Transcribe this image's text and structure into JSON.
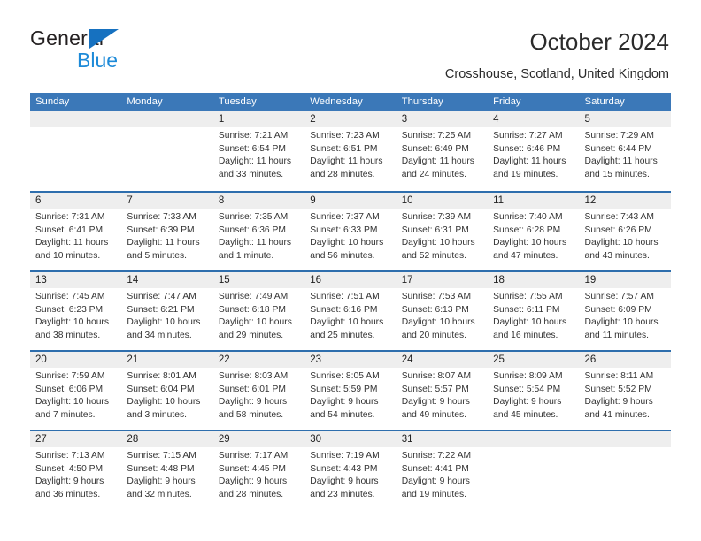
{
  "brand": {
    "name_top": "General",
    "name_bottom": "Blue",
    "accent_blue": "#1671c0",
    "light_blue": "#1d8ad8"
  },
  "header": {
    "title": "October 2024",
    "subtitle": "Crosshouse, Scotland, United Kingdom"
  },
  "calendar": {
    "header_bg": "#3b78b8",
    "row_border": "#2e6ead",
    "day_band_bg": "#eeeeee",
    "weekdays": [
      "Sunday",
      "Monday",
      "Tuesday",
      "Wednesday",
      "Thursday",
      "Friday",
      "Saturday"
    ],
    "weeks": [
      [
        {
          "day": "",
          "sunrise": "",
          "sunset": "",
          "daylight": "",
          "daylight2": ""
        },
        {
          "day": "",
          "sunrise": "",
          "sunset": "",
          "daylight": "",
          "daylight2": ""
        },
        {
          "day": "1",
          "sunrise": "Sunrise: 7:21 AM",
          "sunset": "Sunset: 6:54 PM",
          "daylight": "Daylight: 11 hours",
          "daylight2": "and 33 minutes."
        },
        {
          "day": "2",
          "sunrise": "Sunrise: 7:23 AM",
          "sunset": "Sunset: 6:51 PM",
          "daylight": "Daylight: 11 hours",
          "daylight2": "and 28 minutes."
        },
        {
          "day": "3",
          "sunrise": "Sunrise: 7:25 AM",
          "sunset": "Sunset: 6:49 PM",
          "daylight": "Daylight: 11 hours",
          "daylight2": "and 24 minutes."
        },
        {
          "day": "4",
          "sunrise": "Sunrise: 7:27 AM",
          "sunset": "Sunset: 6:46 PM",
          "daylight": "Daylight: 11 hours",
          "daylight2": "and 19 minutes."
        },
        {
          "day": "5",
          "sunrise": "Sunrise: 7:29 AM",
          "sunset": "Sunset: 6:44 PM",
          "daylight": "Daylight: 11 hours",
          "daylight2": "and 15 minutes."
        }
      ],
      [
        {
          "day": "6",
          "sunrise": "Sunrise: 7:31 AM",
          "sunset": "Sunset: 6:41 PM",
          "daylight": "Daylight: 11 hours",
          "daylight2": "and 10 minutes."
        },
        {
          "day": "7",
          "sunrise": "Sunrise: 7:33 AM",
          "sunset": "Sunset: 6:39 PM",
          "daylight": "Daylight: 11 hours",
          "daylight2": "and 5 minutes."
        },
        {
          "day": "8",
          "sunrise": "Sunrise: 7:35 AM",
          "sunset": "Sunset: 6:36 PM",
          "daylight": "Daylight: 11 hours",
          "daylight2": "and 1 minute."
        },
        {
          "day": "9",
          "sunrise": "Sunrise: 7:37 AM",
          "sunset": "Sunset: 6:33 PM",
          "daylight": "Daylight: 10 hours",
          "daylight2": "and 56 minutes."
        },
        {
          "day": "10",
          "sunrise": "Sunrise: 7:39 AM",
          "sunset": "Sunset: 6:31 PM",
          "daylight": "Daylight: 10 hours",
          "daylight2": "and 52 minutes."
        },
        {
          "day": "11",
          "sunrise": "Sunrise: 7:40 AM",
          "sunset": "Sunset: 6:28 PM",
          "daylight": "Daylight: 10 hours",
          "daylight2": "and 47 minutes."
        },
        {
          "day": "12",
          "sunrise": "Sunrise: 7:43 AM",
          "sunset": "Sunset: 6:26 PM",
          "daylight": "Daylight: 10 hours",
          "daylight2": "and 43 minutes."
        }
      ],
      [
        {
          "day": "13",
          "sunrise": "Sunrise: 7:45 AM",
          "sunset": "Sunset: 6:23 PM",
          "daylight": "Daylight: 10 hours",
          "daylight2": "and 38 minutes."
        },
        {
          "day": "14",
          "sunrise": "Sunrise: 7:47 AM",
          "sunset": "Sunset: 6:21 PM",
          "daylight": "Daylight: 10 hours",
          "daylight2": "and 34 minutes."
        },
        {
          "day": "15",
          "sunrise": "Sunrise: 7:49 AM",
          "sunset": "Sunset: 6:18 PM",
          "daylight": "Daylight: 10 hours",
          "daylight2": "and 29 minutes."
        },
        {
          "day": "16",
          "sunrise": "Sunrise: 7:51 AM",
          "sunset": "Sunset: 6:16 PM",
          "daylight": "Daylight: 10 hours",
          "daylight2": "and 25 minutes."
        },
        {
          "day": "17",
          "sunrise": "Sunrise: 7:53 AM",
          "sunset": "Sunset: 6:13 PM",
          "daylight": "Daylight: 10 hours",
          "daylight2": "and 20 minutes."
        },
        {
          "day": "18",
          "sunrise": "Sunrise: 7:55 AM",
          "sunset": "Sunset: 6:11 PM",
          "daylight": "Daylight: 10 hours",
          "daylight2": "and 16 minutes."
        },
        {
          "day": "19",
          "sunrise": "Sunrise: 7:57 AM",
          "sunset": "Sunset: 6:09 PM",
          "daylight": "Daylight: 10 hours",
          "daylight2": "and 11 minutes."
        }
      ],
      [
        {
          "day": "20",
          "sunrise": "Sunrise: 7:59 AM",
          "sunset": "Sunset: 6:06 PM",
          "daylight": "Daylight: 10 hours",
          "daylight2": "and 7 minutes."
        },
        {
          "day": "21",
          "sunrise": "Sunrise: 8:01 AM",
          "sunset": "Sunset: 6:04 PM",
          "daylight": "Daylight: 10 hours",
          "daylight2": "and 3 minutes."
        },
        {
          "day": "22",
          "sunrise": "Sunrise: 8:03 AM",
          "sunset": "Sunset: 6:01 PM",
          "daylight": "Daylight: 9 hours",
          "daylight2": "and 58 minutes."
        },
        {
          "day": "23",
          "sunrise": "Sunrise: 8:05 AM",
          "sunset": "Sunset: 5:59 PM",
          "daylight": "Daylight: 9 hours",
          "daylight2": "and 54 minutes."
        },
        {
          "day": "24",
          "sunrise": "Sunrise: 8:07 AM",
          "sunset": "Sunset: 5:57 PM",
          "daylight": "Daylight: 9 hours",
          "daylight2": "and 49 minutes."
        },
        {
          "day": "25",
          "sunrise": "Sunrise: 8:09 AM",
          "sunset": "Sunset: 5:54 PM",
          "daylight": "Daylight: 9 hours",
          "daylight2": "and 45 minutes."
        },
        {
          "day": "26",
          "sunrise": "Sunrise: 8:11 AM",
          "sunset": "Sunset: 5:52 PM",
          "daylight": "Daylight: 9 hours",
          "daylight2": "and 41 minutes."
        }
      ],
      [
        {
          "day": "27",
          "sunrise": "Sunrise: 7:13 AM",
          "sunset": "Sunset: 4:50 PM",
          "daylight": "Daylight: 9 hours",
          "daylight2": "and 36 minutes."
        },
        {
          "day": "28",
          "sunrise": "Sunrise: 7:15 AM",
          "sunset": "Sunset: 4:48 PM",
          "daylight": "Daylight: 9 hours",
          "daylight2": "and 32 minutes."
        },
        {
          "day": "29",
          "sunrise": "Sunrise: 7:17 AM",
          "sunset": "Sunset: 4:45 PM",
          "daylight": "Daylight: 9 hours",
          "daylight2": "and 28 minutes."
        },
        {
          "day": "30",
          "sunrise": "Sunrise: 7:19 AM",
          "sunset": "Sunset: 4:43 PM",
          "daylight": "Daylight: 9 hours",
          "daylight2": "and 23 minutes."
        },
        {
          "day": "31",
          "sunrise": "Sunrise: 7:22 AM",
          "sunset": "Sunset: 4:41 PM",
          "daylight": "Daylight: 9 hours",
          "daylight2": "and 19 minutes."
        },
        {
          "day": "",
          "sunrise": "",
          "sunset": "",
          "daylight": "",
          "daylight2": ""
        },
        {
          "day": "",
          "sunrise": "",
          "sunset": "",
          "daylight": "",
          "daylight2": ""
        }
      ]
    ]
  }
}
